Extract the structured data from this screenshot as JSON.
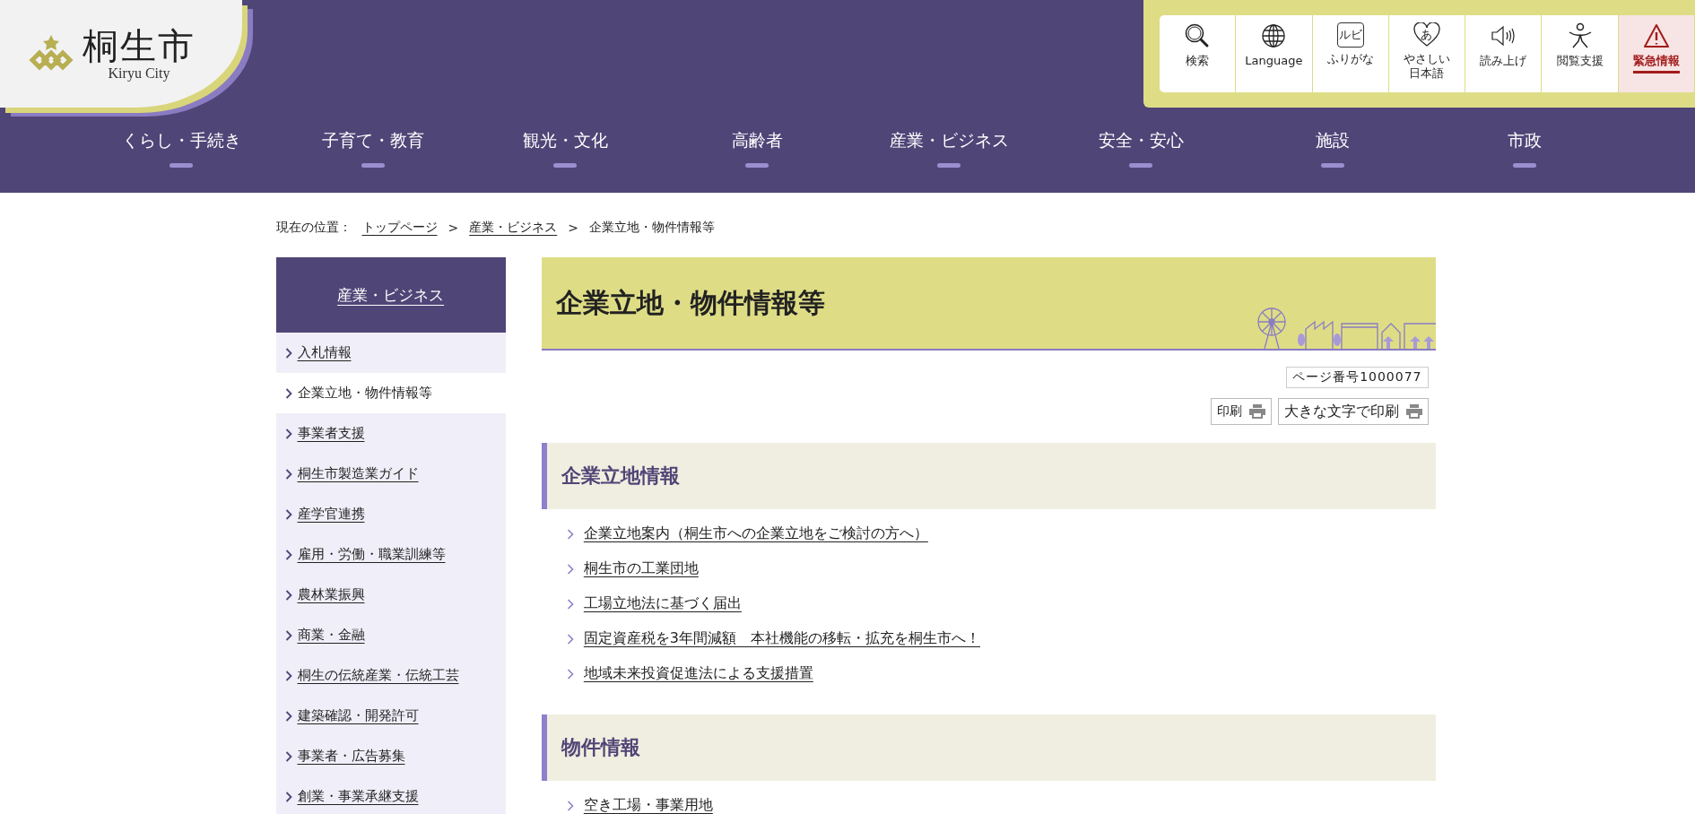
{
  "header": {
    "logo": {
      "name": "桐生市",
      "subtitle": "Kiryu City"
    },
    "tools": [
      {
        "label_lines": [
          "検索"
        ],
        "kind": "normal"
      },
      {
        "label_lines": [
          "Language"
        ],
        "kind": "normal"
      },
      {
        "label_lines": [
          "ふりがな"
        ],
        "icon_text": "ルビ",
        "kind": "normal"
      },
      {
        "label_lines": [
          "やさしい",
          "日本語"
        ],
        "icon_text": "あ",
        "kind": "normal"
      },
      {
        "label_lines": [
          "読み上げ"
        ],
        "kind": "normal"
      },
      {
        "label_lines": [
          "閲覧支援"
        ],
        "kind": "normal"
      },
      {
        "label_lines": [
          "緊急情報"
        ],
        "kind": "emergency"
      }
    ]
  },
  "nav": [
    "くらし・手続き",
    "子育て・教育",
    "観光・文化",
    "高齢者",
    "産業・ビジネス",
    "安全・安心",
    "施設",
    "市政"
  ],
  "breadcrumb": {
    "label": "現在の位置：",
    "separator": ">",
    "items": [
      {
        "text": "トップページ",
        "link": true
      },
      {
        "text": "産業・ビジネス",
        "link": true
      },
      {
        "text": "企業立地・物件情報等",
        "link": false
      }
    ]
  },
  "sidebar": {
    "title": "産業・ビジネス",
    "items": [
      {
        "label": "入札情報",
        "selected": false
      },
      {
        "label": "企業立地・物件情報等",
        "selected": true
      },
      {
        "label": "事業者支援",
        "selected": false
      },
      {
        "label": "桐生市製造業ガイド",
        "selected": false
      },
      {
        "label": "産学官連携",
        "selected": false
      },
      {
        "label": "雇用・労働・職業訓練等",
        "selected": false
      },
      {
        "label": "農林業振興",
        "selected": false
      },
      {
        "label": "商業・金融",
        "selected": false
      },
      {
        "label": "桐生の伝統産業・伝統工芸",
        "selected": false
      },
      {
        "label": "建築確認・開発許可",
        "selected": false
      },
      {
        "label": "事業者・広告募集",
        "selected": false
      },
      {
        "label": "創業・事業承継支援",
        "selected": false
      }
    ]
  },
  "main": {
    "title": "企業立地・物件情報等",
    "page_number": "ページ番号1000077",
    "print_buttons": [
      "印刷",
      "大きな文字で印刷"
    ],
    "sections": [
      {
        "heading": "企業立地情報",
        "links": [
          "企業立地案内（桐生市への企業立地をご検討の方へ）",
          "桐生市の工業団地",
          "工場立地法に基づく届出",
          "固定資産税を3年間減額　本社機能の移転・拡充を桐生市へ！",
          "地域未来投資促進法による支援措置"
        ]
      },
      {
        "heading": "物件情報",
        "links": [
          "空き工場・事業用地"
        ]
      }
    ]
  }
}
